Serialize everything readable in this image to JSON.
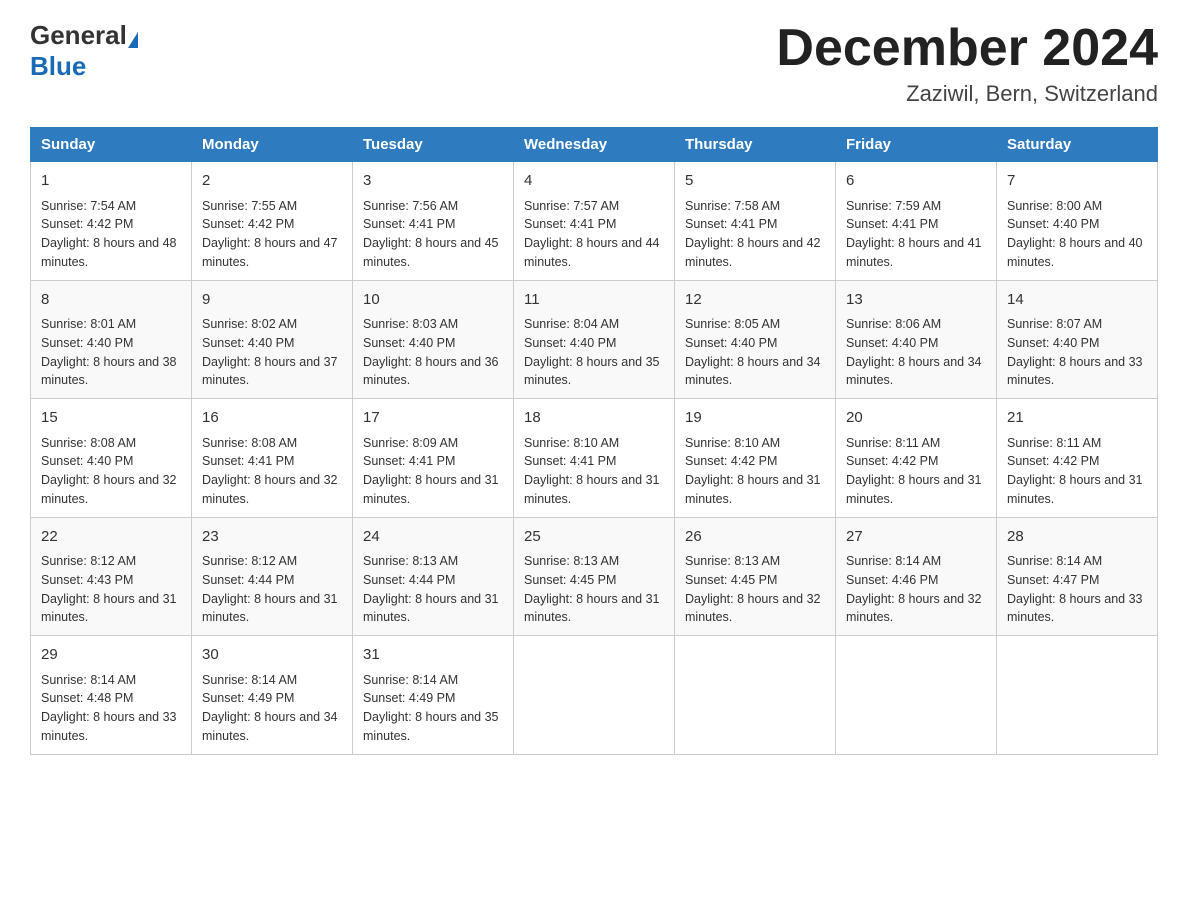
{
  "header": {
    "logo_general": "General",
    "logo_blue": "Blue",
    "month_title": "December 2024",
    "location": "Zaziwil, Bern, Switzerland"
  },
  "days_of_week": [
    "Sunday",
    "Monday",
    "Tuesday",
    "Wednesday",
    "Thursday",
    "Friday",
    "Saturday"
  ],
  "weeks": [
    [
      {
        "day": "1",
        "sunrise": "7:54 AM",
        "sunset": "4:42 PM",
        "daylight": "8 hours and 48 minutes."
      },
      {
        "day": "2",
        "sunrise": "7:55 AM",
        "sunset": "4:42 PM",
        "daylight": "8 hours and 47 minutes."
      },
      {
        "day": "3",
        "sunrise": "7:56 AM",
        "sunset": "4:41 PM",
        "daylight": "8 hours and 45 minutes."
      },
      {
        "day": "4",
        "sunrise": "7:57 AM",
        "sunset": "4:41 PM",
        "daylight": "8 hours and 44 minutes."
      },
      {
        "day": "5",
        "sunrise": "7:58 AM",
        "sunset": "4:41 PM",
        "daylight": "8 hours and 42 minutes."
      },
      {
        "day": "6",
        "sunrise": "7:59 AM",
        "sunset": "4:41 PM",
        "daylight": "8 hours and 41 minutes."
      },
      {
        "day": "7",
        "sunrise": "8:00 AM",
        "sunset": "4:40 PM",
        "daylight": "8 hours and 40 minutes."
      }
    ],
    [
      {
        "day": "8",
        "sunrise": "8:01 AM",
        "sunset": "4:40 PM",
        "daylight": "8 hours and 38 minutes."
      },
      {
        "day": "9",
        "sunrise": "8:02 AM",
        "sunset": "4:40 PM",
        "daylight": "8 hours and 37 minutes."
      },
      {
        "day": "10",
        "sunrise": "8:03 AM",
        "sunset": "4:40 PM",
        "daylight": "8 hours and 36 minutes."
      },
      {
        "day": "11",
        "sunrise": "8:04 AM",
        "sunset": "4:40 PM",
        "daylight": "8 hours and 35 minutes."
      },
      {
        "day": "12",
        "sunrise": "8:05 AM",
        "sunset": "4:40 PM",
        "daylight": "8 hours and 34 minutes."
      },
      {
        "day": "13",
        "sunrise": "8:06 AM",
        "sunset": "4:40 PM",
        "daylight": "8 hours and 34 minutes."
      },
      {
        "day": "14",
        "sunrise": "8:07 AM",
        "sunset": "4:40 PM",
        "daylight": "8 hours and 33 minutes."
      }
    ],
    [
      {
        "day": "15",
        "sunrise": "8:08 AM",
        "sunset": "4:40 PM",
        "daylight": "8 hours and 32 minutes."
      },
      {
        "day": "16",
        "sunrise": "8:08 AM",
        "sunset": "4:41 PM",
        "daylight": "8 hours and 32 minutes."
      },
      {
        "day": "17",
        "sunrise": "8:09 AM",
        "sunset": "4:41 PM",
        "daylight": "8 hours and 31 minutes."
      },
      {
        "day": "18",
        "sunrise": "8:10 AM",
        "sunset": "4:41 PM",
        "daylight": "8 hours and 31 minutes."
      },
      {
        "day": "19",
        "sunrise": "8:10 AM",
        "sunset": "4:42 PM",
        "daylight": "8 hours and 31 minutes."
      },
      {
        "day": "20",
        "sunrise": "8:11 AM",
        "sunset": "4:42 PM",
        "daylight": "8 hours and 31 minutes."
      },
      {
        "day": "21",
        "sunrise": "8:11 AM",
        "sunset": "4:42 PM",
        "daylight": "8 hours and 31 minutes."
      }
    ],
    [
      {
        "day": "22",
        "sunrise": "8:12 AM",
        "sunset": "4:43 PM",
        "daylight": "8 hours and 31 minutes."
      },
      {
        "day": "23",
        "sunrise": "8:12 AM",
        "sunset": "4:44 PM",
        "daylight": "8 hours and 31 minutes."
      },
      {
        "day": "24",
        "sunrise": "8:13 AM",
        "sunset": "4:44 PM",
        "daylight": "8 hours and 31 minutes."
      },
      {
        "day": "25",
        "sunrise": "8:13 AM",
        "sunset": "4:45 PM",
        "daylight": "8 hours and 31 minutes."
      },
      {
        "day": "26",
        "sunrise": "8:13 AM",
        "sunset": "4:45 PM",
        "daylight": "8 hours and 32 minutes."
      },
      {
        "day": "27",
        "sunrise": "8:14 AM",
        "sunset": "4:46 PM",
        "daylight": "8 hours and 32 minutes."
      },
      {
        "day": "28",
        "sunrise": "8:14 AM",
        "sunset": "4:47 PM",
        "daylight": "8 hours and 33 minutes."
      }
    ],
    [
      {
        "day": "29",
        "sunrise": "8:14 AM",
        "sunset": "4:48 PM",
        "daylight": "8 hours and 33 minutes."
      },
      {
        "day": "30",
        "sunrise": "8:14 AM",
        "sunset": "4:49 PM",
        "daylight": "8 hours and 34 minutes."
      },
      {
        "day": "31",
        "sunrise": "8:14 AM",
        "sunset": "4:49 PM",
        "daylight": "8 hours and 35 minutes."
      },
      null,
      null,
      null,
      null
    ]
  ],
  "labels": {
    "sunrise_prefix": "Sunrise: ",
    "sunset_prefix": "Sunset: ",
    "daylight_prefix": "Daylight: "
  }
}
